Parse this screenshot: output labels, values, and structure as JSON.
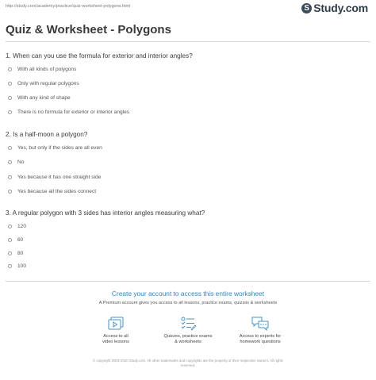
{
  "header": {
    "url": "http://study.com/academy/practice/quiz-worksheet-polygons.html",
    "logo_text": "Study.com",
    "logo_mark": "S"
  },
  "title": "Quiz & Worksheet - Polygons",
  "questions": [
    {
      "text": "1. When can you use the formula for exterior and interior angles?",
      "options": [
        "With all kinds of polygons",
        "Only with regular polygons",
        "With any kind of shape",
        "There is no formula for exterior or interior angles"
      ]
    },
    {
      "text": "2. Is a half-moon a polygon?",
      "options": [
        "Yes, but only if the sides are all even",
        "No",
        "Yes because it has one straight side",
        "Yes because all the sides connect"
      ]
    },
    {
      "text": "3. A regular polygon with 3 sides has interior angles measuring what?",
      "options": [
        "120",
        "60",
        "80",
        "100"
      ]
    }
  ],
  "cta": {
    "title": "Create your account to access this entire worksheet",
    "subtitle": "A Premium account gives you access to all lessons, practice exams, quizzes & worksheets",
    "features": [
      {
        "icon": "video-lessons-icon",
        "line1": "Access to all",
        "line2": "video lessons"
      },
      {
        "icon": "quizzes-checklist-icon",
        "line1": "Quizzes, practice exams",
        "line2": "& worksheets"
      },
      {
        "icon": "experts-chat-icon",
        "line1": "Access to experts for",
        "line2": "homework questions"
      }
    ]
  },
  "footer": {
    "line1": "© copyright 2003-2020 Study.com. All other trademarks and copyrights are the property of their respective owners. All rights",
    "line2": "reserved."
  },
  "colors": {
    "accent": "#2e86c1",
    "icon": "#4a90c2"
  }
}
